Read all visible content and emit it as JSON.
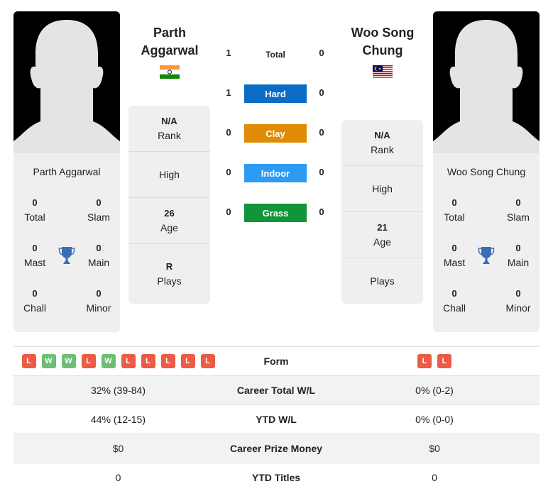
{
  "colors": {
    "win": "#6cbf73",
    "loss": "#ee5a44",
    "hard": "#0a6cc4",
    "clay": "#e08c06",
    "indoor": "#2b9bf4",
    "grass": "#109538",
    "trophy": "#3a6fb8"
  },
  "player1": {
    "name": "Parth Aggarwal",
    "heading_line1": "Parth",
    "heading_line2": "Aggarwal",
    "flag": "india-flag",
    "titles": {
      "total": {
        "value": "0",
        "label": "Total"
      },
      "slam": {
        "value": "0",
        "label": "Slam"
      },
      "mast": {
        "value": "0",
        "label": "Mast"
      },
      "main": {
        "value": "0",
        "label": "Main"
      },
      "chall": {
        "value": "0",
        "label": "Chall"
      },
      "minor": {
        "value": "0",
        "label": "Minor"
      }
    },
    "info": {
      "rank": {
        "value": "N/A",
        "label": "Rank"
      },
      "high": {
        "value": "",
        "label": "High"
      },
      "age": {
        "value": "26",
        "label": "Age"
      },
      "plays": {
        "value": "R",
        "label": "Plays"
      }
    }
  },
  "player2": {
    "name": "Woo Song Chung",
    "heading_line1": "Woo Song",
    "heading_line2": "Chung",
    "flag": "malaysia-flag",
    "titles": {
      "total": {
        "value": "0",
        "label": "Total"
      },
      "slam": {
        "value": "0",
        "label": "Slam"
      },
      "mast": {
        "value": "0",
        "label": "Mast"
      },
      "main": {
        "value": "0",
        "label": "Main"
      },
      "chall": {
        "value": "0",
        "label": "Chall"
      },
      "minor": {
        "value": "0",
        "label": "Minor"
      }
    },
    "info": {
      "rank": {
        "value": "N/A",
        "label": "Rank"
      },
      "high": {
        "value": "",
        "label": "High"
      },
      "age": {
        "value": "21",
        "label": "Age"
      },
      "plays": {
        "value": "",
        "label": "Plays"
      }
    }
  },
  "h2h": {
    "total": {
      "label": "Total",
      "p1": "1",
      "p2": "0"
    },
    "surfaces": [
      {
        "label": "Hard",
        "p1": "1",
        "p2": "0",
        "color_key": "hard"
      },
      {
        "label": "Clay",
        "p1": "0",
        "p2": "0",
        "color_key": "clay"
      },
      {
        "label": "Indoor",
        "p1": "0",
        "p2": "0",
        "color_key": "indoor"
      },
      {
        "label": "Grass",
        "p1": "0",
        "p2": "0",
        "color_key": "grass"
      }
    ]
  },
  "comparison": {
    "form": {
      "label": "Form",
      "p1": [
        "L",
        "W",
        "W",
        "L",
        "W",
        "L",
        "L",
        "L",
        "L",
        "L"
      ],
      "p2": [
        "L",
        "L"
      ]
    },
    "rows": [
      {
        "label": "Career Total W/L",
        "p1": "32% (39-84)",
        "p2": "0% (0-2)"
      },
      {
        "label": "YTD W/L",
        "p1": "44% (12-15)",
        "p2": "0% (0-0)"
      },
      {
        "label": "Career Prize Money",
        "p1": "$0",
        "p2": "$0"
      },
      {
        "label": "YTD Titles",
        "p1": "0",
        "p2": "0"
      }
    ]
  }
}
